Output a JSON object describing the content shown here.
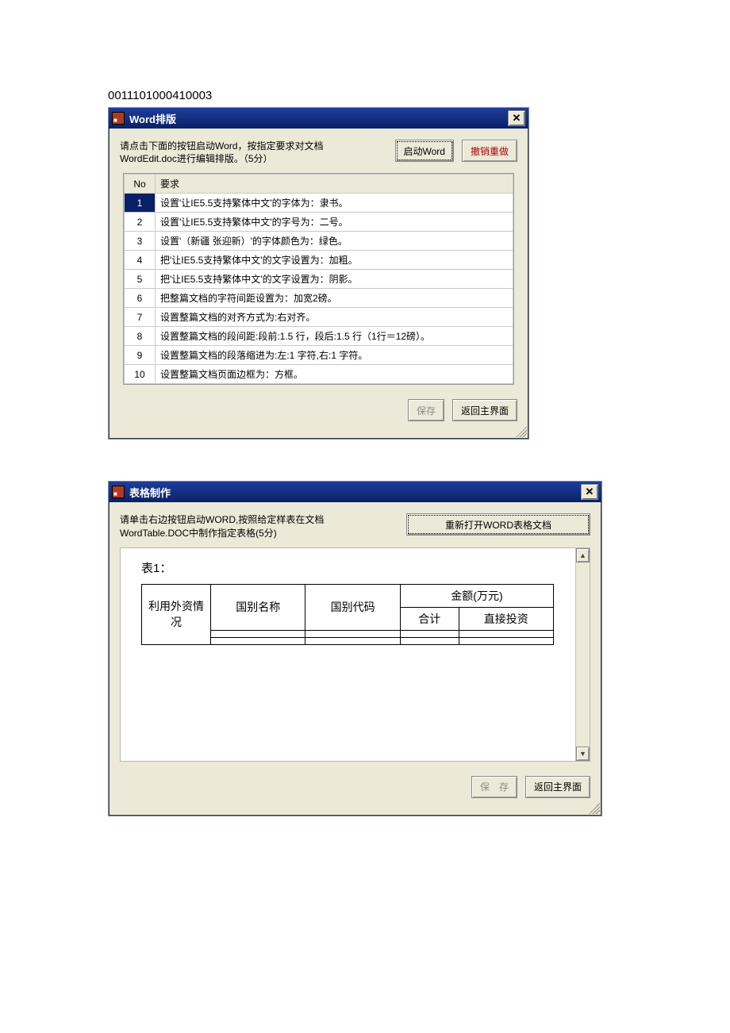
{
  "page_code": "0011101000410003",
  "window1": {
    "title": "Word排版",
    "instruction": "请点击下面的按钮启动Word，按指定要求对文档WordEdit.doc进行编辑排版。（5分）",
    "launch_button": "启动Word",
    "undo_button": "撤销重做",
    "grid_headers": {
      "no": "No",
      "req": "要求"
    },
    "rows": [
      {
        "no": "1",
        "text": "设置'让IE5.5支持繁体中文'的字体为：隶书。"
      },
      {
        "no": "2",
        "text": "设置'让IE5.5支持繁体中文'的字号为：二号。"
      },
      {
        "no": "3",
        "text": "设置'（新疆 张迎新）'的字体颜色为：绿色。"
      },
      {
        "no": "4",
        "text": "把'让IE5.5支持繁体中文'的文字设置为：加粗。"
      },
      {
        "no": "5",
        "text": "把'让IE5.5支持繁体中文'的文字设置为：阴影。"
      },
      {
        "no": "6",
        "text": "把整篇文档的字符间距设置为：加宽2磅。"
      },
      {
        "no": "7",
        "text": "设置整篇文档的对齐方式为:右对齐。"
      },
      {
        "no": "8",
        "text": "设置整篇文档的段间距:段前:1.5 行，段后:1.5 行（1行＝12磅）。"
      },
      {
        "no": "9",
        "text": "设置整篇文档的段落缩进为:左:1 字符,右:1 字符。"
      },
      {
        "no": "10",
        "text": "设置整篇文档页面边框为：方框。"
      }
    ],
    "save_button": "保存",
    "return_button": "返回主界面"
  },
  "window2": {
    "title": "表格制作",
    "instruction": "请单击右边按钮启动WORD,按照给定样表在文档WordTable.DOC中制作指定表格(5分)",
    "reopen_button": "重新打开WORD表格文档",
    "doc_title": "表1：",
    "table_headers": {
      "r1c1": "利用外资情况",
      "name": "国别名称",
      "code": "国别代码",
      "amount": "金额(万元)",
      "total": "合计",
      "direct": "直接投资"
    },
    "save_button": "保　存",
    "return_button": "返回主界面"
  }
}
